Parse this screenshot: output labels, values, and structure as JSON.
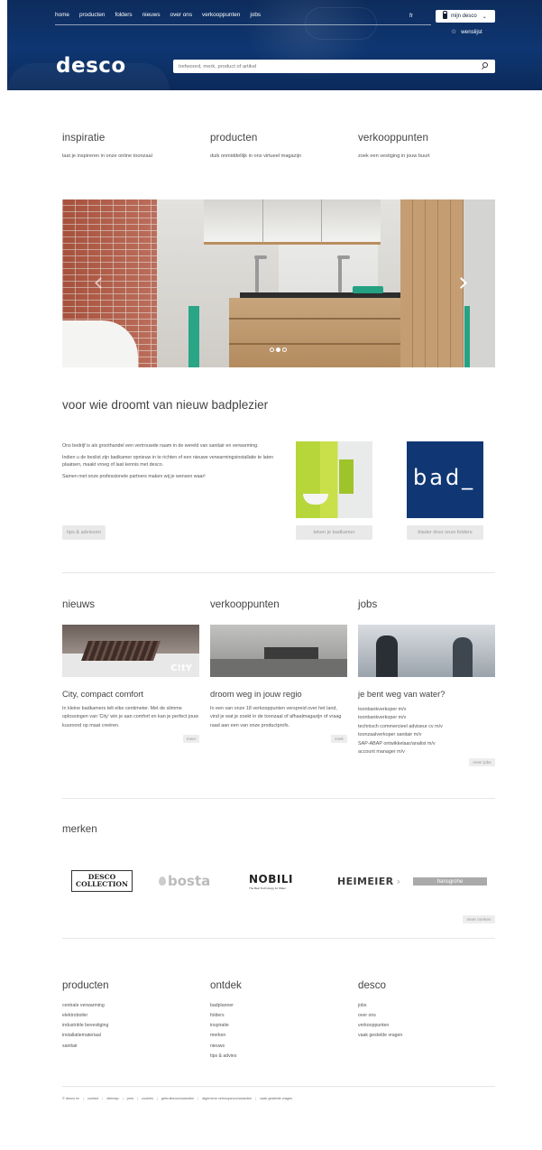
{
  "header": {
    "nav": [
      "home",
      "producten",
      "folders",
      "nieuws",
      "over ons",
      "verkooppunten",
      "jobs"
    ],
    "language": "fr",
    "account_label": "mijn desco",
    "wishlist_label": "wenslijst",
    "logo": "desco",
    "search_placeholder": "trefwoord, merk, product of artikel"
  },
  "intro": [
    {
      "title": "inspiratie",
      "text": "laat je inspireren in onze online toonzaal"
    },
    {
      "title": "producten",
      "text": "duik onmiddellijk in ons virtueel magazijn"
    },
    {
      "title": "verkooppunten",
      "text": "zoek een vestiging in jouw buurt"
    }
  ],
  "hero": {
    "slides": 3,
    "active": 2
  },
  "dream": {
    "title": "voor wie droomt van nieuw badplezier",
    "paragraphs": [
      "Ons bedrijf is als groothandel een vertrouwde naam in de wereld van sanitair en verwarming.",
      "Indien u de beslist zijn badkamer opnieuw in te richten of een nieuwe verwarmingsinstallatie te laten plaatsen, maakt vroeg of laat kennis met desco.",
      "Samen met onze professionele partners maken wij je wensen waar!"
    ],
    "btn_tips": "tips & adviezen",
    "btn_plan": "teken je badkamer",
    "btn_folders": "blader door onze folders",
    "thumb2_text": "bad_"
  },
  "cards": {
    "news": {
      "section": "nieuws",
      "title": "City, compact comfort",
      "text": "In kleine badkamers telt elke centimeter. Met de slimme oplossingen van 'City' win je aan comfort en kan je perfect jouw kuuroord op maat creëren.",
      "more": "meer",
      "img_label": "C!tY"
    },
    "vk": {
      "section": "verkooppunten",
      "title": "droom weg in jouw regio",
      "text": "In een van onze 18 verkooppunten verspreid over het land, vind je wat je zoekt in de toonzaal of afhaalmagazijn of vraag raad aan een van onze productprofs.",
      "more": "zoek"
    },
    "jobs": {
      "section": "jobs",
      "title": "je bent weg van water?",
      "list": [
        "toonbankverkoper m/v",
        "toonbankverkoper m/v",
        "technisch commercieel adviseur cv m/v",
        "toonzaalverkoper sanitair m/v",
        "SAP-ABAP ontwikkelaar/analist m/v",
        "account manager m/v"
      ],
      "more": "meer jobs"
    }
  },
  "brands": {
    "title": "merken",
    "desco_line1": "DESCO",
    "desco_line2": "COLLECTION",
    "bosta": "bosta",
    "nobili": "NOBILI",
    "nobili_sub": "The Best Technology for Water",
    "heimeier": "HEIMEIER",
    "hansgrohe": "hansgrohe",
    "more": "meer merken"
  },
  "footer": {
    "cols": [
      {
        "title": "producten",
        "items": [
          "centrale verwarming",
          "elektroboiler",
          "industriële bevestiging",
          "installatiemateriaal",
          "sanitair"
        ]
      },
      {
        "title": "ontdek",
        "items": [
          "badplanner",
          "folders",
          "inspiratie",
          "merken",
          "nieuws",
          "tips & advies"
        ]
      },
      {
        "title": "desco",
        "items": [
          "jobs",
          "over ons",
          "verkooppunten",
          "vaak gestelde vragen"
        ]
      }
    ],
    "legal": [
      "© desco nv",
      "contact",
      "sitemap",
      "pers",
      "cookies",
      "gebruiksvoorwaarden",
      "algemene verkoopsvoorwaarden",
      "vaak gestelde vragen"
    ]
  }
}
